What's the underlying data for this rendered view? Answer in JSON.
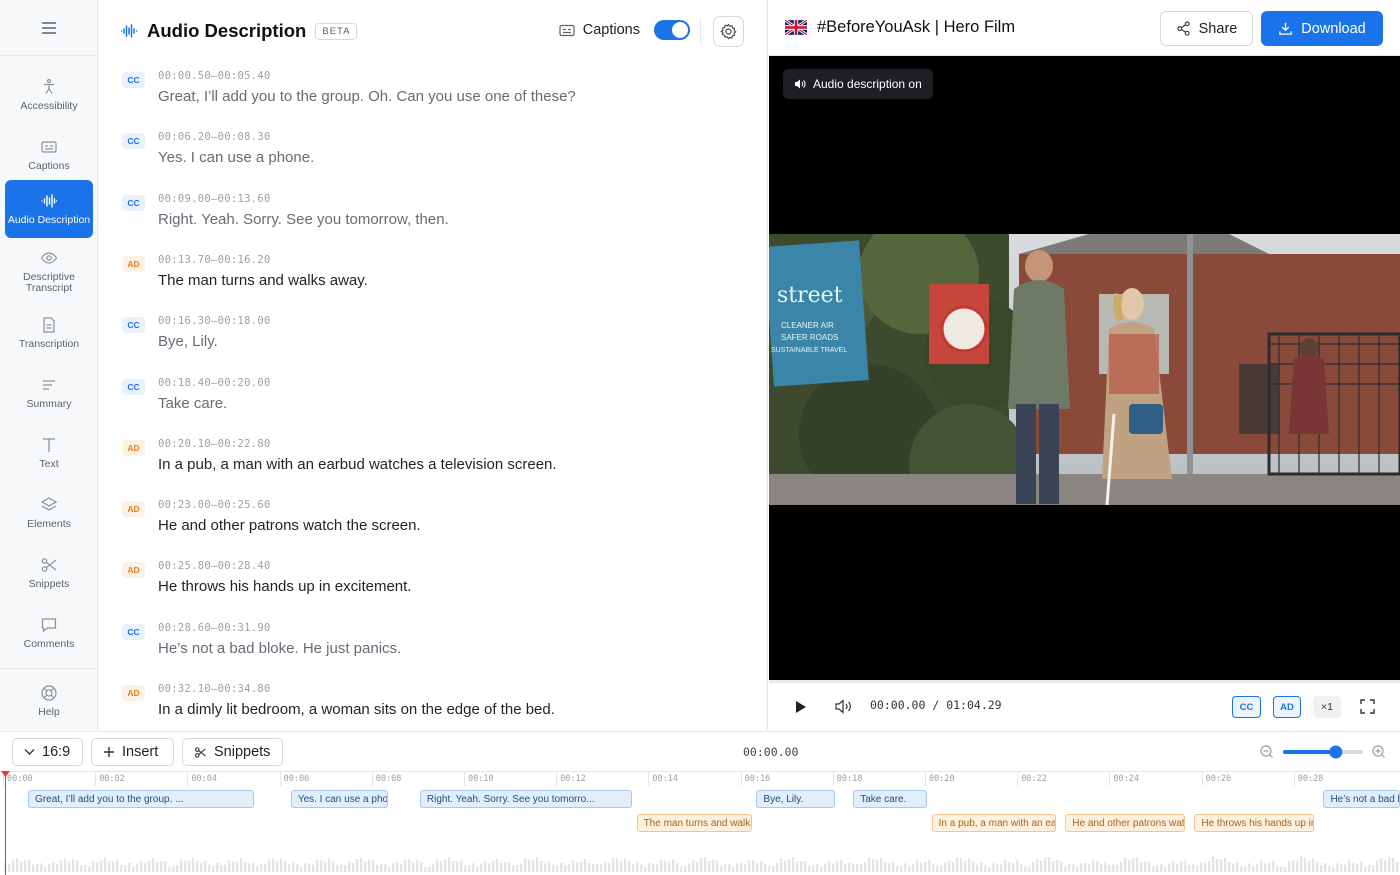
{
  "sidebar": {
    "items": [
      {
        "label": "Accessibility",
        "icon": "accessibility-icon"
      },
      {
        "label": "Captions",
        "icon": "captions-icon"
      },
      {
        "label": "Audio Description",
        "icon": "audio-wave-icon",
        "active": true
      },
      {
        "label": "Descriptive Transcript",
        "icon": "eye-icon"
      },
      {
        "label": "Transcription",
        "icon": "document-icon"
      },
      {
        "label": "Summary",
        "icon": "summary-lines-icon"
      },
      {
        "label": "Text",
        "icon": "text-t-icon"
      },
      {
        "label": "Elements",
        "icon": "layers-icon"
      },
      {
        "label": "Snippets",
        "icon": "scissors-icon"
      },
      {
        "label": "Comments",
        "icon": "comment-icon"
      }
    ],
    "help_label": "Help"
  },
  "transcript": {
    "title": "Audio Description",
    "badge": "BETA",
    "captions_label": "Captions",
    "captions_on": true,
    "entries": [
      {
        "type": "CC",
        "time": "00:00.50–00:05.40",
        "text": "Great, I’ll add you to the group. Oh. Can you use one of these?"
      },
      {
        "type": "CC",
        "time": "00:06.20–00:08.30",
        "text": "Yes. I can use a phone."
      },
      {
        "type": "CC",
        "time": "00:09.00–00:13.60",
        "text": "Right. Yeah. Sorry. See you tomorrow, then."
      },
      {
        "type": "AD",
        "time": "00:13.70–00:16.20",
        "text": "The man turns and walks away."
      },
      {
        "type": "CC",
        "time": "00:16.30–00:18.00",
        "text": "Bye, Lily."
      },
      {
        "type": "CC",
        "time": "00:18.40–00:20.00",
        "text": "Take care."
      },
      {
        "type": "AD",
        "time": "00:20.10–00:22.80",
        "text": "In a pub, a man with an earbud watches a television screen."
      },
      {
        "type": "AD",
        "time": "00:23.00–00:25.60",
        "text": "He and other patrons watch the screen."
      },
      {
        "type": "AD",
        "time": "00:25.80–00:28.40",
        "text": "He throws his hands up in excitement."
      },
      {
        "type": "CC",
        "time": "00:28.60–00:31.90",
        "text": "He’s not a bad bloke. He just panics."
      },
      {
        "type": "AD",
        "time": "00:32.10–00:34.80",
        "text": "In a dimly lit bedroom, a woman sits on the edge of the bed."
      }
    ]
  },
  "header": {
    "project_title": "#BeforeYouAsk | Hero Film",
    "share_label": "Share",
    "download_label": "Download"
  },
  "player": {
    "ad_indicator": "Audio description on",
    "current_time": "00:00.00",
    "separator": "/",
    "duration": "01:04.29",
    "cc_label": "CC",
    "ad_label": "AD",
    "speed_label": "×1",
    "scene_texts": [
      "street",
      "CLEANER AIR",
      "SAFER ROADS",
      "SUSTAINABLE TRAVEL"
    ]
  },
  "timeline": {
    "aspect_label": "16:9",
    "insert_label": "Insert",
    "snippets_label": "Snippets",
    "current_time": "00:00.00",
    "zoom_level": 0.66,
    "ticks": [
      "00:00",
      "00:02",
      "00:04",
      "00:06",
      "00:08",
      "00:10",
      "00:12",
      "00:14",
      "00:16",
      "00:18",
      "00:20",
      "00:22",
      "00:24",
      "00:26",
      "00:28"
    ],
    "cc_clips": [
      "Great, I’ll add you to the group. ...",
      "Yes. I can use a phone.",
      "Right. Yeah. Sorry. See you tomorro...",
      "Bye, Lily.",
      "Take care.",
      "He’s not a bad bloke."
    ],
    "ad_clips": [
      "The man turns and walks away.",
      "In a pub, a man with an earbud",
      "He and other patrons watch",
      "He throws his hands up in"
    ]
  },
  "colors": {
    "accent": "#1a73e8",
    "cc": "#1a73e8",
    "ad": "#d9822b",
    "playhead": "#e53935"
  }
}
